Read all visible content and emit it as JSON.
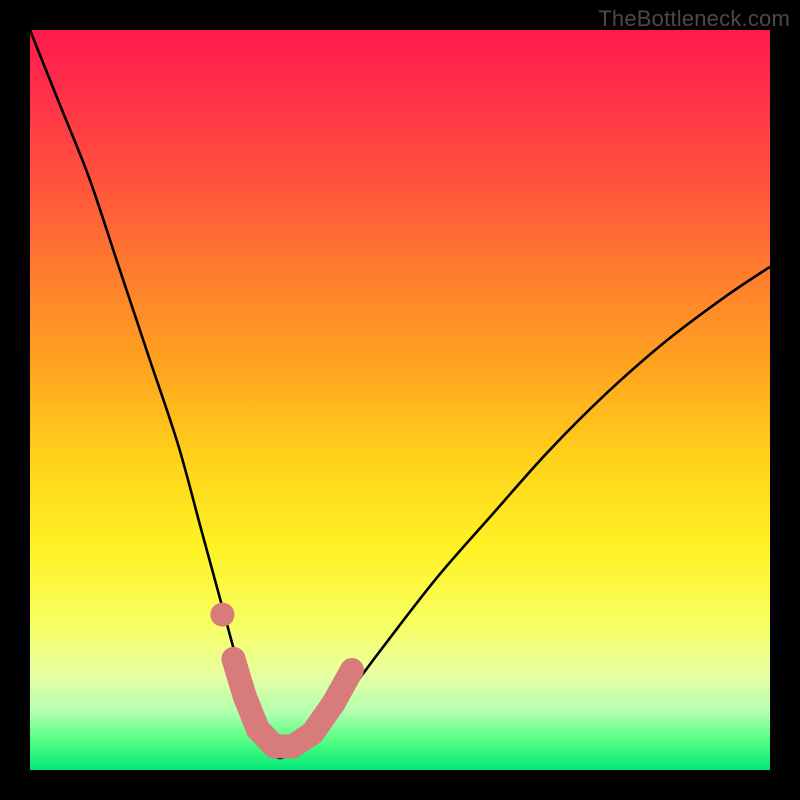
{
  "watermark": "TheBottleneck.com",
  "chart_data": {
    "type": "line",
    "title": "",
    "xlabel": "",
    "ylabel": "",
    "xlim": [
      0,
      100
    ],
    "ylim": [
      0,
      100
    ],
    "series": [
      {
        "name": "bottleneck-curve",
        "x": [
          0,
          4,
          8,
          12,
          16,
          20,
          23,
          26,
          28.5,
          31,
          33,
          35,
          38,
          42,
          48,
          55,
          62,
          70,
          78,
          86,
          94,
          100
        ],
        "values": [
          100,
          90,
          80,
          68,
          56,
          44,
          33,
          22,
          13,
          6,
          2,
          2,
          4,
          9,
          17,
          26,
          34,
          43,
          51,
          58,
          64,
          68
        ]
      }
    ],
    "markers": [
      {
        "name": "left-segment-upper",
        "x": 26.0,
        "y": 21.0
      },
      {
        "name": "left-segment-mid",
        "x": 27.5,
        "y": 15.0
      },
      {
        "name": "left-segment-lower",
        "x": 29.0,
        "y": 10.0
      },
      {
        "name": "valley-left",
        "x": 30.8,
        "y": 5.5
      },
      {
        "name": "valley-center-a",
        "x": 33.0,
        "y": 3.2
      },
      {
        "name": "valley-center-b",
        "x": 35.5,
        "y": 3.2
      },
      {
        "name": "valley-right",
        "x": 38.2,
        "y": 5.0
      },
      {
        "name": "right-segment-lower",
        "x": 41.0,
        "y": 9.0
      },
      {
        "name": "right-segment-upper",
        "x": 43.5,
        "y": 13.5
      }
    ],
    "marker_color": "#d77b7b",
    "curve_color": "#000000"
  }
}
